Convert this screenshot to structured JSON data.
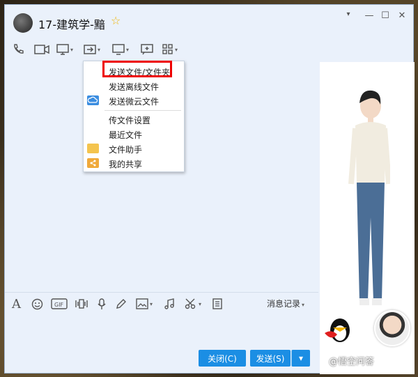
{
  "window": {
    "title": "17-建筑学-黯",
    "controls": [
      "▾",
      "—",
      "☐",
      "✕"
    ]
  },
  "toolbar": {
    "icons": [
      "phone-icon",
      "video-icon",
      "screen-share-icon",
      "file-transfer-icon",
      "remote-desktop-icon",
      "add-chat-icon",
      "apps-icon"
    ]
  },
  "file_menu": {
    "items": [
      {
        "label": "发送文件/文件夹",
        "icon": ""
      },
      {
        "label": "发送离线文件",
        "icon": ""
      },
      {
        "label": "发送微云文件",
        "icon": "cloud-icon"
      },
      {
        "label": "传文件设置",
        "icon": ""
      },
      {
        "label": "最近文件",
        "icon": ""
      },
      {
        "label": "文件助手",
        "icon": "folder-icon"
      },
      {
        "label": "我的共享",
        "icon": "share-folder-icon"
      }
    ]
  },
  "input_toolbar": {
    "history_label": "消息记录",
    "icons": [
      "font-icon",
      "emoji-icon",
      "gif-icon",
      "video-clip-icon",
      "mic-icon",
      "pen-icon",
      "image-icon",
      "music-icon",
      "scissors-icon",
      "document-icon"
    ]
  },
  "buttons": {
    "close_label": "关闭(C)",
    "send_label": "发送(S)"
  },
  "colors": {
    "accent": "#1b8ee4",
    "window_bg": "#eaf1fb",
    "highlight": "#e00000"
  },
  "watermark": "@悟空问答"
}
